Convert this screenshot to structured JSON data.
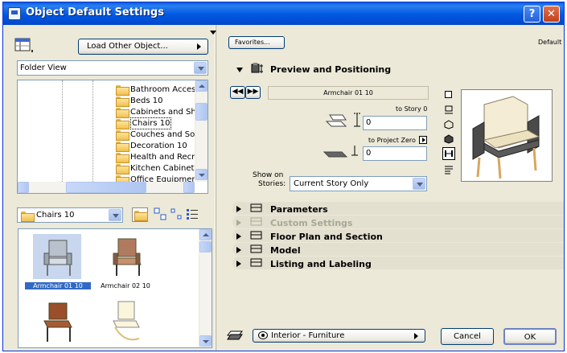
{
  "window": {
    "title": "Object Default Settings"
  },
  "left": {
    "load_other_label": "Load Other Object...",
    "view_select": "Folder View",
    "tree_items": [
      {
        "label": "Bathroom Access"
      },
      {
        "label": "Beds 10"
      },
      {
        "label": "Cabinets and Sh"
      },
      {
        "label": "Chairs 10"
      },
      {
        "label": "Couches and Sof"
      },
      {
        "label": "Decoration 10"
      },
      {
        "label": "Health and Recre"
      },
      {
        "label": "Kitchen Cabinets"
      },
      {
        "label": "Office Equipment"
      }
    ],
    "folder_select": "Chairs 10",
    "items": [
      {
        "label": "Armchair 01 10"
      },
      {
        "label": "Armchair 02 10"
      },
      {
        "label": ""
      },
      {
        "label": ""
      }
    ]
  },
  "right": {
    "favorites_label": "Favorites...",
    "default_label": "Default",
    "preview_section": "Preview and Positioning",
    "object_name": "Armchair 01 10",
    "to_story_label": "to Story 0",
    "story_value": "0",
    "to_project_zero_label": "to Project Zero",
    "zero_value": "0",
    "show_on_label_1": "Show on",
    "show_on_label_2": "Stories:",
    "show_on_value": "Current Story Only",
    "sections": [
      {
        "label": "Parameters",
        "enabled": true
      },
      {
        "label": "Custom Settings",
        "enabled": false
      },
      {
        "label": "Floor Plan and Section",
        "enabled": true
      },
      {
        "label": "Model",
        "enabled": true
      },
      {
        "label": "Listing and Labeling",
        "enabled": true
      }
    ],
    "layer_value": "Interior - Furniture",
    "cancel_label": "Cancel",
    "ok_label": "OK"
  },
  "colors": {
    "titlebar": "#0058e0",
    "selection": "#316ac5",
    "dialog_bg": "#ece9d8"
  }
}
